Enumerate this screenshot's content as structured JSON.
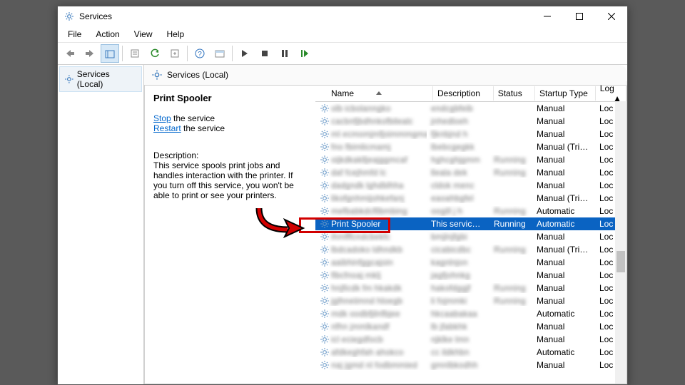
{
  "window": {
    "title": "Services"
  },
  "menubar": [
    "File",
    "Action",
    "View",
    "Help"
  ],
  "tree": {
    "root": "Services (Local)"
  },
  "detail": {
    "header": "Services (Local)",
    "selected_name": "Print Spooler",
    "stop_link": "Stop",
    "stop_tail": " the service",
    "restart_link": "Restart",
    "restart_tail": " the service",
    "desc_label": "Description:",
    "desc_text": "This service spools print jobs and handles interaction with the printer. If you turn off this service, you won't be able to print or see your printers."
  },
  "columns": {
    "name": "Name",
    "desc": "Description",
    "stat": "Status",
    "start": "Startup Type",
    "log": "Log"
  },
  "rows": [
    {
      "startup": "Manual",
      "log": "Loc"
    },
    {
      "startup": "Manual",
      "log": "Loc"
    },
    {
      "startup": "Manual",
      "log": "Loc"
    },
    {
      "startup": "Manual (Trig...",
      "log": "Loc"
    },
    {
      "status": "Running",
      "startup": "Manual",
      "log": "Loc"
    },
    {
      "status": "Running",
      "startup": "Manual",
      "log": "Loc"
    },
    {
      "startup": "Manual",
      "log": "Loc"
    },
    {
      "startup": "Manual (Trig...",
      "log": "Loc"
    },
    {
      "status": "Running",
      "startup": "Automatic",
      "log": "Loc"
    },
    {
      "name": "Print Spooler",
      "desc": "This service ...",
      "status": "Running",
      "startup": "Automatic",
      "log": "Loc",
      "selected": true
    },
    {
      "startup": "Manual",
      "log": "Loc"
    },
    {
      "status": "Running",
      "startup": "Manual (Trig...",
      "log": "Loc"
    },
    {
      "startup": "Manual",
      "log": "Loc"
    },
    {
      "startup": "Manual",
      "log": "Loc"
    },
    {
      "status": "Running",
      "startup": "Manual",
      "log": "Loc"
    },
    {
      "status": "Running",
      "startup": "Manual",
      "log": "Loc"
    },
    {
      "startup": "Automatic",
      "log": "Loc"
    },
    {
      "startup": "Manual",
      "log": "Loc"
    },
    {
      "startup": "Manual",
      "log": "Loc"
    },
    {
      "startup": "Automatic",
      "log": "Loc"
    },
    {
      "startup": "Manual",
      "log": "Loc"
    }
  ]
}
